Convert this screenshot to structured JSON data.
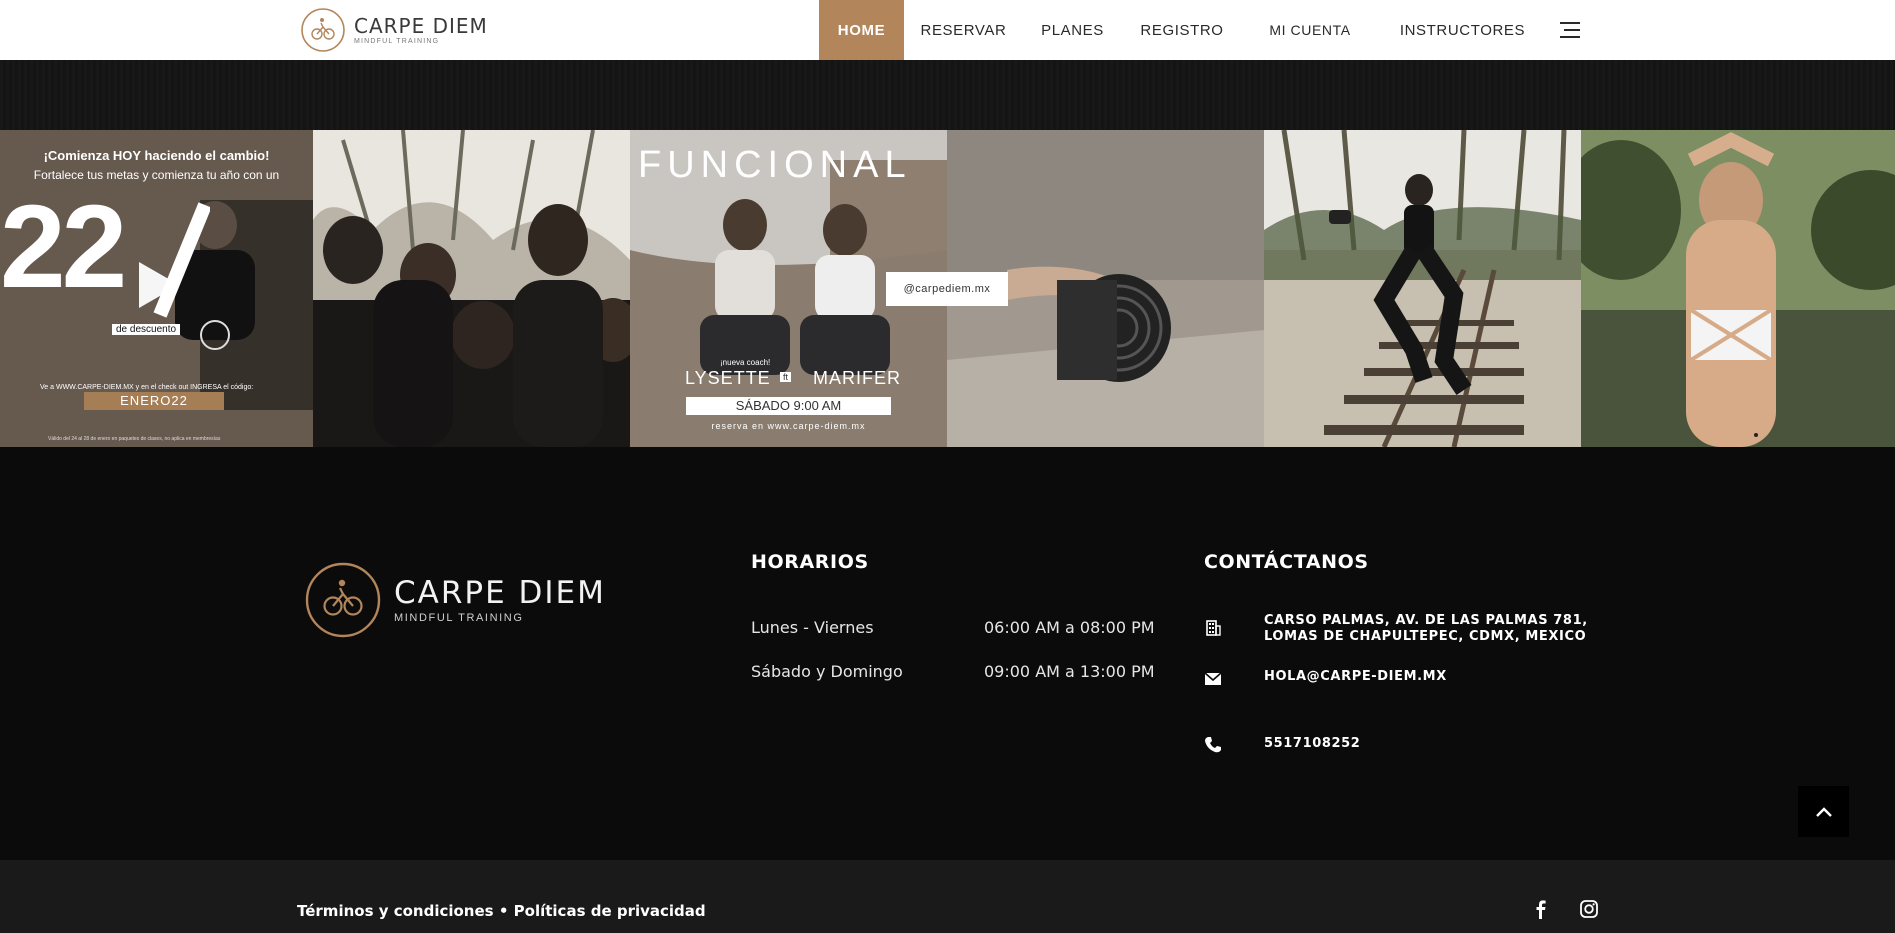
{
  "header": {
    "brand_name": "CARPE DIEM",
    "brand_tagline": "MINDFUL TRAINING",
    "nav": [
      {
        "label": "HOME",
        "active": true
      },
      {
        "label": "RESERVAR"
      },
      {
        "label": "PLANES"
      },
      {
        "label": "REGISTRO"
      },
      {
        "label": "MI CUENTA"
      },
      {
        "label": "INSTRUCTORES"
      }
    ],
    "menu_icon": "hamburger-icon",
    "accent_color": "#b3855a"
  },
  "gallery": {
    "instagram_handle": "@carpediem.mx",
    "promo": {
      "headline": "¡Comienza HOY haciendo el cambio!",
      "subline": "Fortalece tus metas y comienza tu año con un",
      "discount": "22",
      "discount_suffix": "de descuento",
      "instructions": "Ve a WWW.CARPE-DIEM.MX y en el check out INGRESA el código:",
      "code": "ENERO22",
      "fine_print": "Válido del 24 al 28 de enero en paquetes de clases, no aplica en membresías"
    },
    "funcional": {
      "title": "FUNCIONAL",
      "kicker": "¡nueva coach!",
      "coach_1": "LYSETTE",
      "ft": "ft",
      "coach_2": "MARIFER",
      "time": "SÁBADO 9:00 AM",
      "reserve": "reserva en www.carpe-diem.mx"
    }
  },
  "footer": {
    "brand_name": "CARPE DIEM",
    "brand_tagline": "MINDFUL TRAINING",
    "hours_title": "HORARIOS",
    "hours": [
      {
        "day": "Lunes - Viernes",
        "time": "06:00 AM a 08:00 PM"
      },
      {
        "day": "Sábado y Domingo",
        "time": "09:00 AM a 13:00 PM"
      }
    ],
    "contact_title": "CONTÁCTANOS",
    "address_line1": "CARSO PALMAS, AV. DE LAS PALMAS 781,",
    "address_line2": "LOMAS DE CHAPULTEPEC, CDMX, MEXICO",
    "email": "HOLA@CARPE-DIEM.MX",
    "phone": "5517108252",
    "terms": "Términos y condiciones",
    "separator": "•",
    "privacy": "Políticas de privacidad"
  }
}
